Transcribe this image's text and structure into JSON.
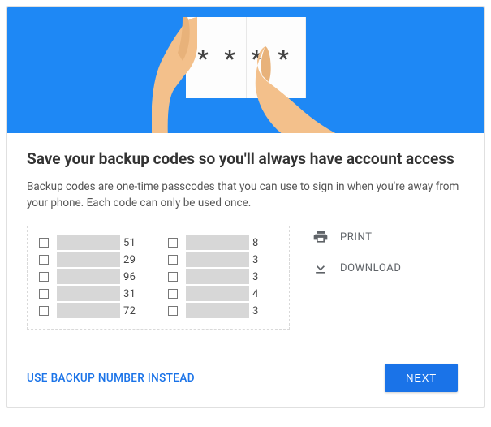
{
  "hero": {
    "stars": "* * * *"
  },
  "title": "Save your backup codes so you'll always have account access",
  "description": "Backup codes are one-time passcodes that you can use to sign in when you're away from your phone. Each code can only be used once.",
  "codes": {
    "col1": [
      "51",
      "29",
      "96",
      "31",
      "72"
    ],
    "col2": [
      "8",
      "3",
      "3",
      "4",
      "3"
    ]
  },
  "actions": {
    "print": "PRINT",
    "download": "DOWNLOAD"
  },
  "footer": {
    "alt_link": "USE BACKUP NUMBER INSTEAD",
    "next": "NEXT"
  }
}
